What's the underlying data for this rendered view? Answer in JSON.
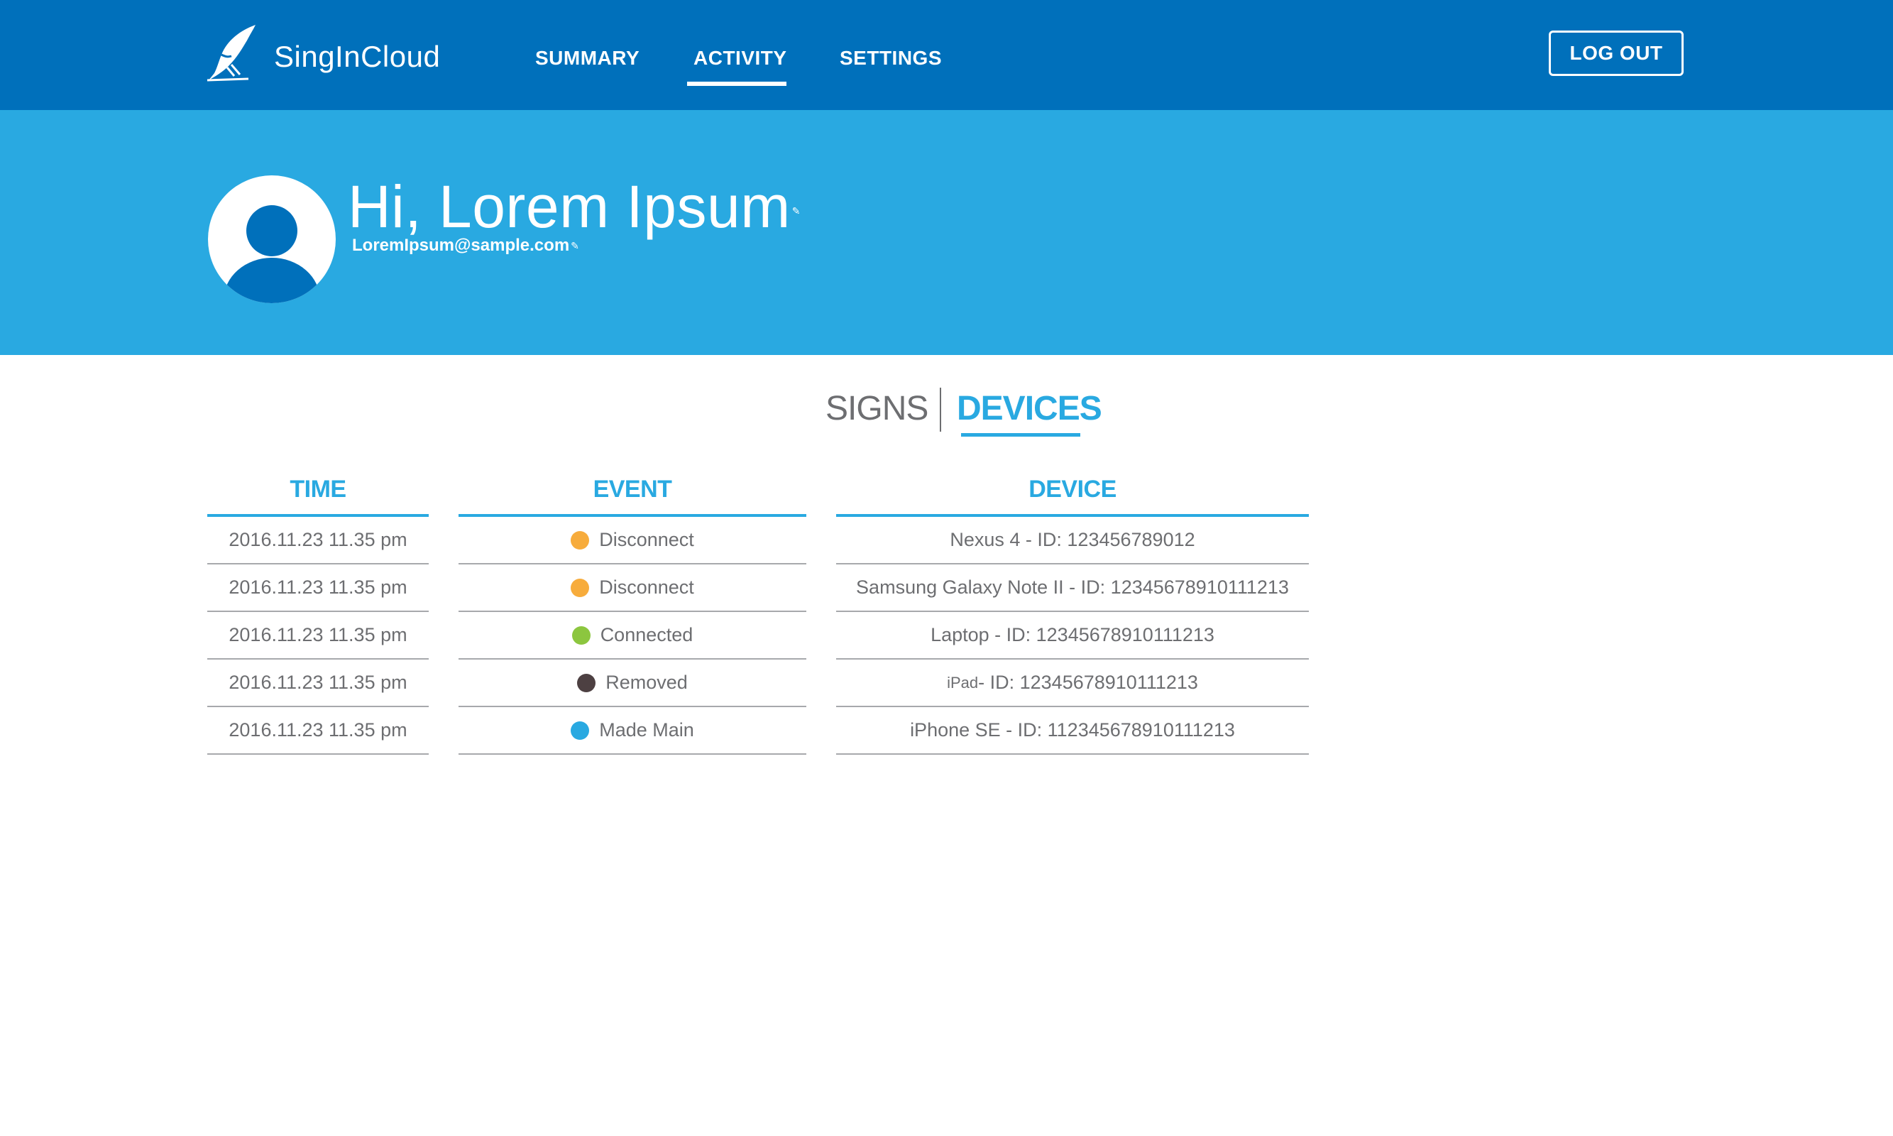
{
  "app": {
    "brand": "SingInCloud"
  },
  "nav": {
    "items": [
      {
        "label": "SUMMARY"
      },
      {
        "label": "ACTIVITY",
        "active": true
      },
      {
        "label": "SETTINGS"
      }
    ],
    "logout_label": "LOG OUT"
  },
  "profile": {
    "greeting": "Hi, Lorem Ipsum",
    "email": "LoremIpsum@sample.com"
  },
  "tabs": {
    "signs_label": "SIGNS",
    "devices_label": "DEVICES",
    "active": "DEVICES"
  },
  "table": {
    "headers": {
      "time": "TIME",
      "event": "EVENT",
      "device": "DEVICE"
    },
    "rows": [
      {
        "time": "2016.11.23 11.35 pm",
        "event": "Disconnect",
        "status_color": "#f7ac3c",
        "device_prefix": "",
        "device": "Nexus 4 - ID: 123456789012"
      },
      {
        "time": "2016.11.23 11.35 pm",
        "event": "Disconnect",
        "status_color": "#f7ac3c",
        "device_prefix": "",
        "device": "Samsung Galaxy Note II -  ID: 12345678910111213"
      },
      {
        "time": "2016.11.23 11.35 pm",
        "event": "Connected",
        "status_color": "#8cc63f",
        "device_prefix": "",
        "device": "Laptop -  ID: 12345678910111213"
      },
      {
        "time": "2016.11.23 11.35 pm",
        "event": "Removed",
        "status_color": "#4d4042",
        "device_prefix": "iPad",
        "device": " - ID: 12345678910111213"
      },
      {
        "time": "2016.11.23 11.35 pm",
        "event": "Made Main",
        "status_color": "#29a9e1",
        "device_prefix": "",
        "device": "iPhone SE - ID: 112345678910111213"
      }
    ]
  },
  "colors": {
    "nav_bg": "#0070bb",
    "hero_bg": "#29a9e1",
    "accent": "#29a9e1",
    "text_gray": "#6d6e71"
  },
  "icons": {
    "logo": "quill-bird-icon",
    "edit": "edit-icon"
  }
}
